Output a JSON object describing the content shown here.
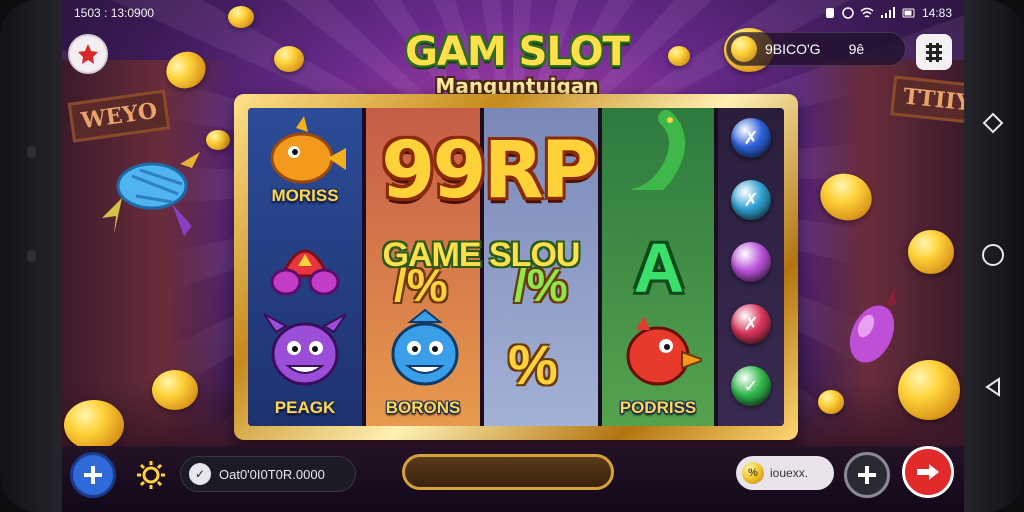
{
  "status_bar": {
    "left_text": "1503 : 13:0900",
    "right_text": "14:83"
  },
  "header": {
    "title": "GAM SLOT",
    "subtitle": "Manguntuigan",
    "balance": "9BICO'G",
    "balance_extra": "9ê"
  },
  "background": {
    "left_sign": "WEYO",
    "right_sign": "TTIIY"
  },
  "reels": {
    "big_prize": "99RP",
    "banner": "GAME SLOU",
    "big_letter": "A",
    "row1_labels": [
      "MORISS"
    ],
    "row3_labels": [
      "PEAGK",
      "BORONS",
      "PODRISS"
    ]
  },
  "side_orbs": [
    {
      "glyph": "✗",
      "color": "#2b5fd9"
    },
    {
      "glyph": "✗",
      "color": "#2f9fd0"
    },
    {
      "glyph": "",
      "color": "#b84fd8"
    },
    {
      "glyph": "✗",
      "color": "#d8345a"
    },
    {
      "glyph": "✓",
      "color": "#2fb84a"
    }
  ],
  "bottom_bar": {
    "ticker_text": "Oat0'0I0T0R.0000",
    "ticker_icon": "✓",
    "small_pill_text": "iouexx.",
    "small_pill_icon": "%"
  },
  "colors": {
    "accent_gold": "#ffd23a",
    "add_button": "#2f6ad8",
    "close_button": "#e32a2a"
  }
}
